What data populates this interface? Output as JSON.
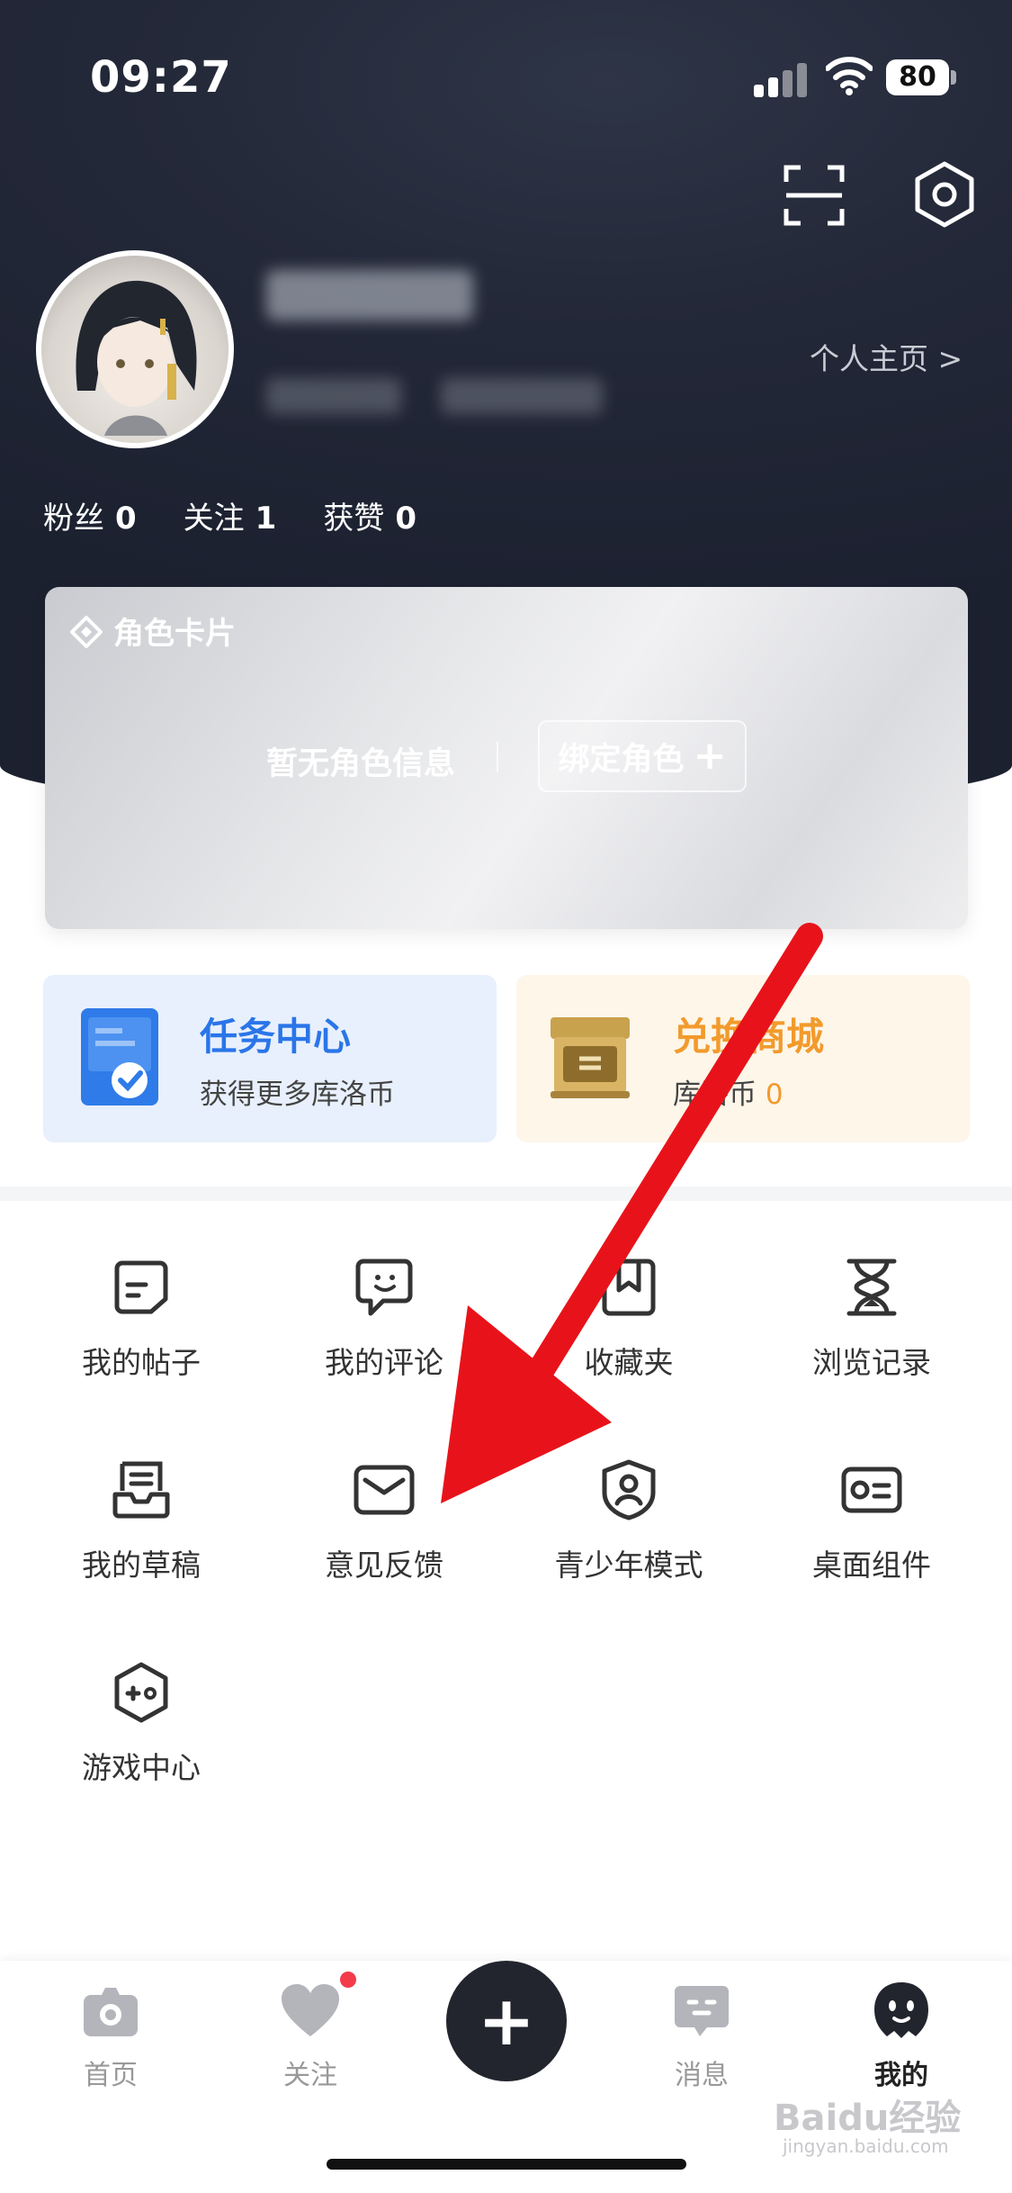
{
  "status_bar": {
    "time": "09:27",
    "battery": "80"
  },
  "header": {
    "profile_link": "个人主页 >",
    "stats": [
      {
        "label": "粉丝",
        "value": "0"
      },
      {
        "label": "关注",
        "value": "1"
      },
      {
        "label": "获赞",
        "value": "0"
      }
    ]
  },
  "role_card": {
    "title": "角色卡片",
    "empty_text": "暂无角色信息",
    "bind_label": "绑定角色",
    "bind_plus": "+"
  },
  "task_card": {
    "title": "任务中心",
    "subtitle": "获得更多库洛币"
  },
  "shop_card": {
    "title": "兑换商城",
    "subtitle": "库洛币",
    "coins": "0"
  },
  "menu": [
    {
      "label": "我的帖子",
      "icon": "post-icon"
    },
    {
      "label": "我的评论",
      "icon": "comment-icon"
    },
    {
      "label": "收藏夹",
      "icon": "bookmark-icon"
    },
    {
      "label": "浏览记录",
      "icon": "hourglass-icon"
    },
    {
      "label": "我的草稿",
      "icon": "draft-icon"
    },
    {
      "label": "意见反馈",
      "icon": "mail-icon"
    },
    {
      "label": "青少年模式",
      "icon": "shield-icon"
    },
    {
      "label": "桌面组件",
      "icon": "widget-card-icon"
    },
    {
      "label": "游戏中心",
      "icon": "gamepad-icon"
    }
  ],
  "tabbar": {
    "tabs": [
      {
        "label": "首页"
      },
      {
        "label": "关注"
      },
      {
        "label": "消息"
      },
      {
        "label": "我的"
      }
    ],
    "add_label": "+"
  },
  "watermark": {
    "main": "Baidu经验",
    "sub": "jingyan.baidu.com"
  },
  "colors": {
    "header_bg": "#232838",
    "task_accent": "#2a75e8",
    "shop_accent": "#f29a2c",
    "arrow": "#e8131a",
    "notification_dot": "#f33b4a"
  }
}
